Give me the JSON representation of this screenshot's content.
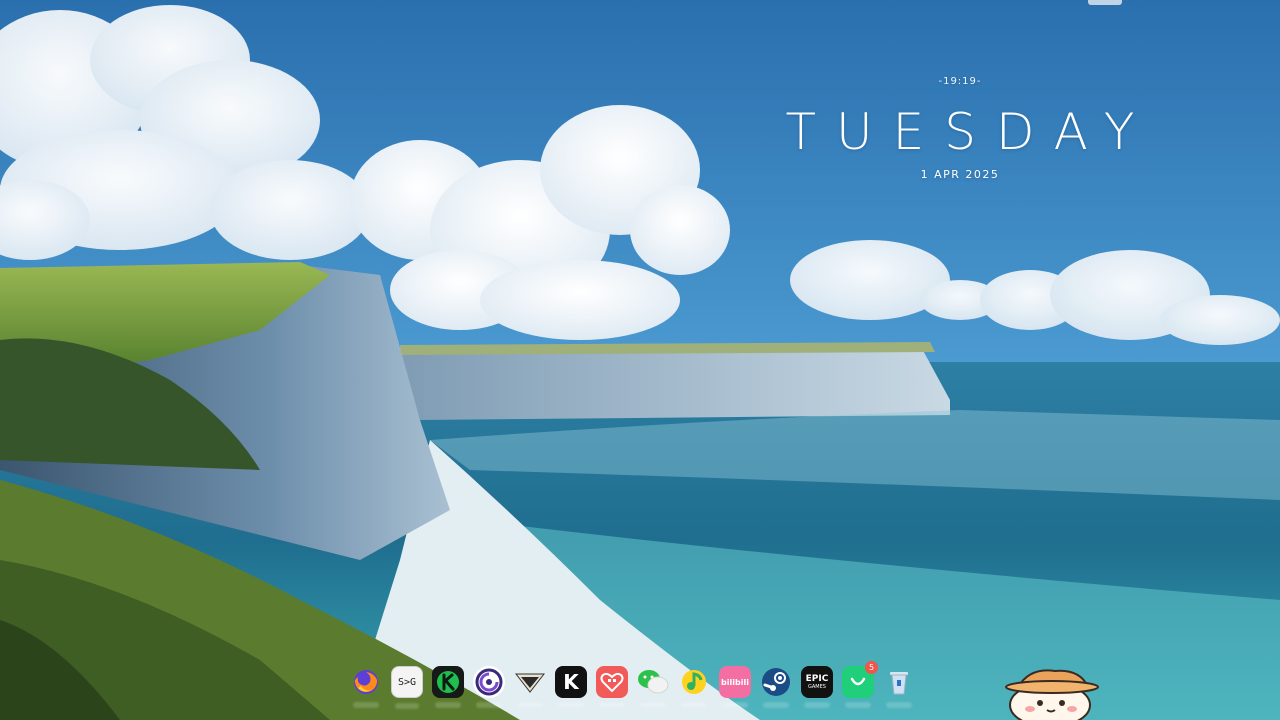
{
  "clock": {
    "time": "-19:19-",
    "day": "TUESDAY",
    "date": "1 APR 2025"
  },
  "dock": {
    "items": [
      {
        "name": "firefox",
        "icon": "firefox-icon"
      },
      {
        "name": "terminal",
        "icon": "terminal-icon",
        "label": "S>G"
      },
      {
        "name": "app-green",
        "icon": "green-k-icon"
      },
      {
        "name": "ubisoft",
        "icon": "ubisoft-icon"
      },
      {
        "name": "warframe",
        "icon": "warframe-icon"
      },
      {
        "name": "kuro",
        "icon": "kuro-k-icon",
        "label": "K"
      },
      {
        "name": "heart-app",
        "icon": "pixel-heart-icon"
      },
      {
        "name": "wechat",
        "icon": "wechat-icon"
      },
      {
        "name": "qq-music",
        "icon": "qq-music-icon"
      },
      {
        "name": "bilibili",
        "icon": "bilibili-icon",
        "label": "bilibili"
      },
      {
        "name": "steam",
        "icon": "steam-icon"
      },
      {
        "name": "epic-games",
        "icon": "epic-games-icon",
        "label1": "EPIC",
        "label2": "GAMES"
      },
      {
        "name": "shopping-bag",
        "icon": "shopping-bag-icon",
        "badge": "5"
      },
      {
        "name": "trash",
        "icon": "trash-icon"
      }
    ]
  },
  "colors": {
    "sky_top": "#2a6fae",
    "sky_mid": "#4e9ed4",
    "sea": "#1f6e8f",
    "grass": "#6d9a3a",
    "cliff": "#5e7f9e"
  }
}
